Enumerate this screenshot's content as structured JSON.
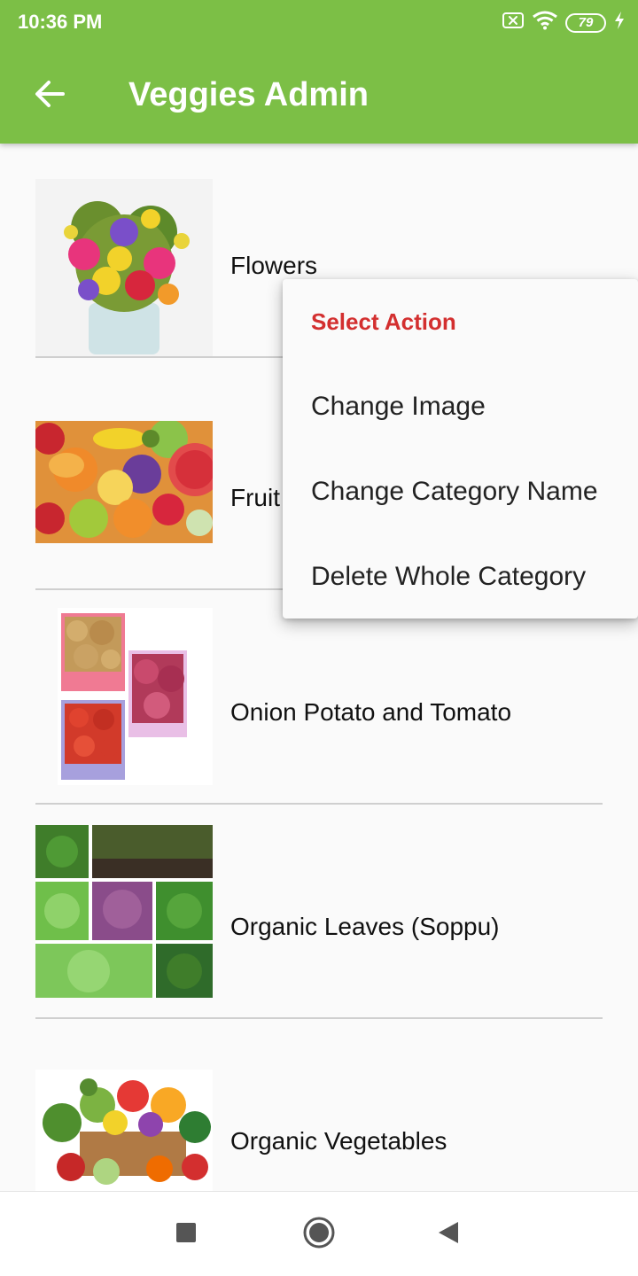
{
  "status_bar": {
    "time": "10:36 PM",
    "battery": "79",
    "icons": [
      "sim-off-icon",
      "wifi-icon",
      "battery-icon",
      "charging-icon"
    ]
  },
  "app_bar": {
    "title": "Veggies Admin",
    "back_icon": "arrow-back-icon"
  },
  "categories": [
    {
      "name": "Flowers"
    },
    {
      "name": "Fruit"
    },
    {
      "name": "Onion Potato and Tomato"
    },
    {
      "name": "Organic Leaves (Soppu)"
    },
    {
      "name": "Organic Vegetables"
    }
  ],
  "context_menu": {
    "header": "Select Action",
    "items": [
      {
        "label": "Change Image"
      },
      {
        "label": "Change Category Name"
      },
      {
        "label": "Delete Whole Category"
      }
    ]
  },
  "nav_bar": {
    "icons": [
      "recent-apps-icon",
      "home-icon",
      "back-icon"
    ]
  },
  "colors": {
    "primary": "#7cbf46",
    "accent_header": "#d32f2f",
    "background": "#fafafa",
    "divider": "#cfcfcf"
  }
}
